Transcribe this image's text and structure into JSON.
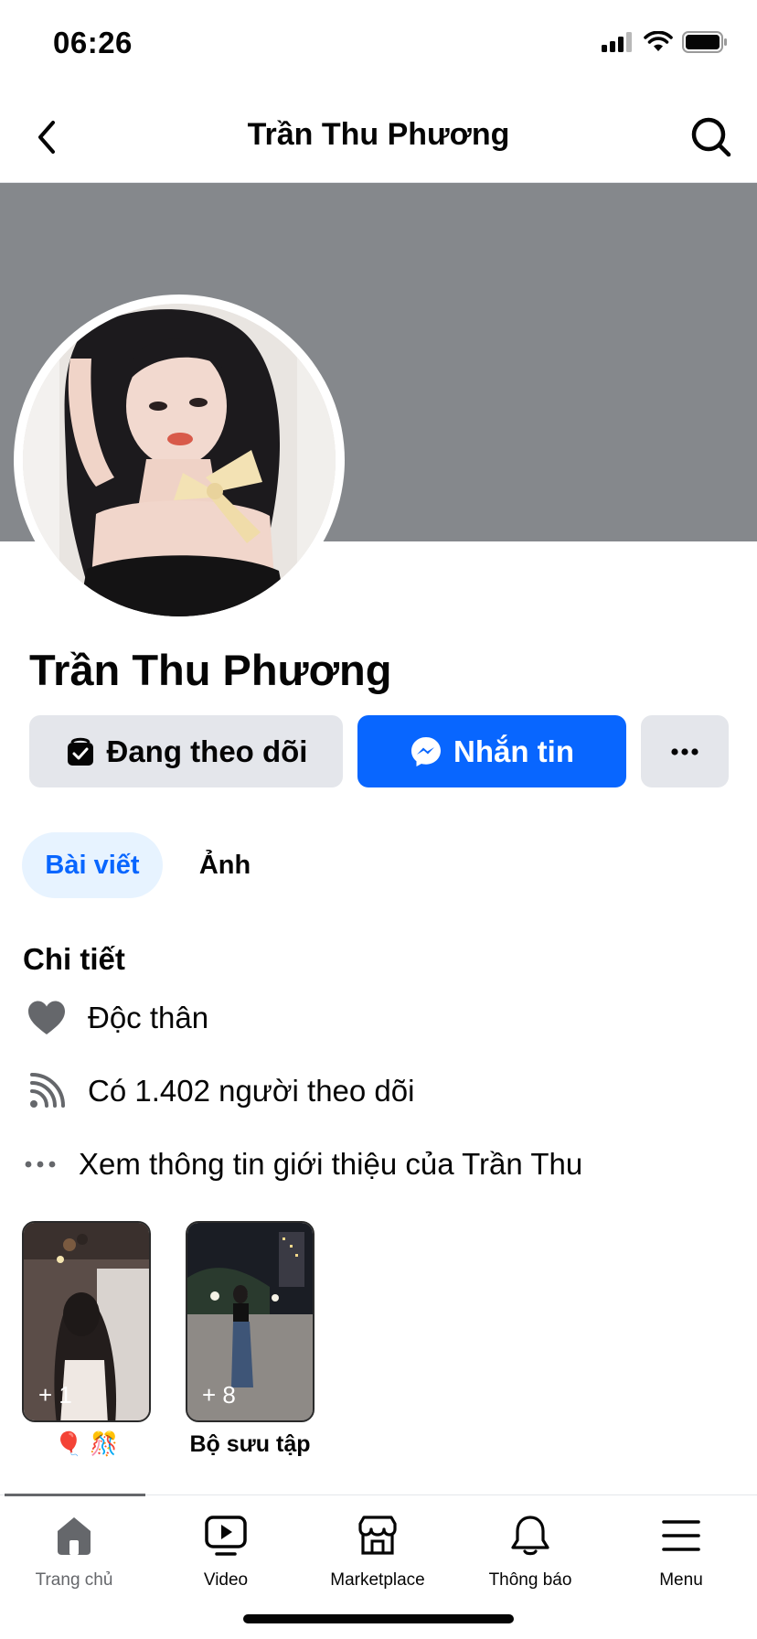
{
  "status_bar": {
    "time": "06:26"
  },
  "nav": {
    "title": "Trần Thu Phương"
  },
  "profile": {
    "name": "Trần Thu Phương",
    "follow_button": "Đang theo dõi",
    "message_button": "Nhắn tin",
    "more_button": "..."
  },
  "tabs": [
    {
      "label": "Bài viết",
      "active": true
    },
    {
      "label": "Ảnh",
      "active": false
    }
  ],
  "details": {
    "title": "Chi tiết",
    "items": [
      {
        "icon": "heart-icon",
        "text": "Độc thân"
      },
      {
        "icon": "rss-feed-icon",
        "text": "Có 1.402 người theo dõi"
      },
      {
        "icon": "more-dots-icon",
        "text": "Xem thông tin giới thiệu của Trần Thu"
      }
    ]
  },
  "highlights": [
    {
      "count": "+ 1",
      "label": "🎈 🎊"
    },
    {
      "count": "+ 8",
      "label": "Bộ sưu tập"
    }
  ],
  "bottom_nav": [
    {
      "icon": "home-icon",
      "label": "Trang chủ",
      "active": true
    },
    {
      "icon": "video-icon",
      "label": "Video",
      "active": false
    },
    {
      "icon": "marketplace-icon",
      "label": "Marketplace",
      "active": false
    },
    {
      "icon": "bell-icon",
      "label": "Thông báo",
      "active": false
    },
    {
      "icon": "menu-icon",
      "label": "Menu",
      "active": false
    }
  ],
  "colors": {
    "accent": "#0866ff",
    "cover": "#85888c",
    "button_gray": "#e4e6eb",
    "tab_active_bg": "#e7f3ff"
  }
}
